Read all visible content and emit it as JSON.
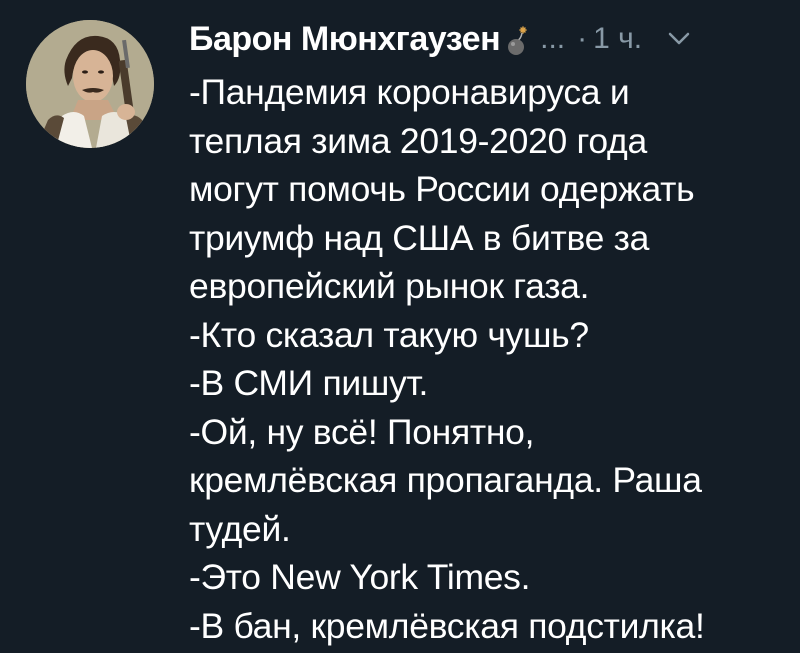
{
  "tweet": {
    "author": "Барон Мюнхгаузен",
    "handle": "...",
    "separator": "·",
    "time": "1 ч.",
    "lines": [
      "-Пандемия коронавируса и",
      "теплая зима 2019-2020 года",
      "могут помочь России одержать",
      "триумф над США в битве за",
      "европейский рынок газа.",
      "-Кто сказал такую чушь?",
      "-В СМИ пишут.",
      "-Ой, ну всё! Понятно,",
      "кремлёвская пропаганда. Раша",
      "тудей.",
      "-Это New York Times.",
      "-В бан, кремлёвская подстилка!"
    ]
  },
  "icons": {
    "avatar": "avatar-photo",
    "badge": "bomb-icon",
    "menu": "chevron-down-icon"
  },
  "colors": {
    "background": "#141d26",
    "text": "#ffffff",
    "muted": "#8899a6"
  }
}
